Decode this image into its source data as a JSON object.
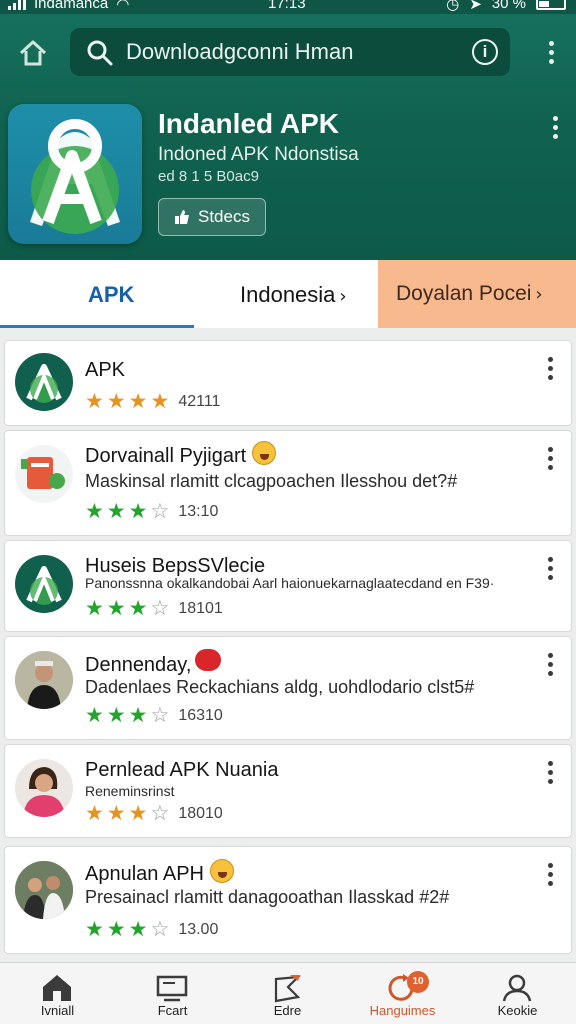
{
  "status_bar": {
    "carrier": "Indamanca",
    "time": "17:13",
    "battery": "30 %"
  },
  "search": {
    "query": "Downloadgconni Hman"
  },
  "app": {
    "title": "Indanled APK",
    "subtitle": "Indoned APK Ndonstisa",
    "meta": "ed 8 1 5 B0ac9",
    "stat_button": "Stdecs"
  },
  "tabs": [
    {
      "label": "APK"
    },
    {
      "label": "Indonesia"
    },
    {
      "label": "Doyalan Pocei"
    }
  ],
  "list": [
    {
      "title": "APK",
      "desc": "",
      "rating": 4,
      "count": "42111",
      "star_color": "#e7931f"
    },
    {
      "title": "Dorvainall Pyjigart",
      "desc": "Maskinsal rlamitt clcagpoachen Ilesshou det?#",
      "rating": 3,
      "count": "13:10",
      "star_color": "#22a52b"
    },
    {
      "title": "Huseis BepsSVlecie",
      "desc": "Panonssnna okalkandobai Aarl haionuekarnaglaatecdand en F39·",
      "rating": 3,
      "count": "18101",
      "star_color": "#22a52b"
    },
    {
      "title": "Dennenday,",
      "desc": "Dadenlaes Reckachians aldg, uohdlodario clst5#",
      "rating": 3,
      "count": "16310",
      "star_color": "#22a52b"
    },
    {
      "title": "Pernlead APK Nuania",
      "desc": "Reneminsrinst",
      "rating": 3,
      "count": "18010",
      "star_color": "#e7931f"
    },
    {
      "title": "Apnulan APH",
      "desc": "Presainacl rlamitt danagooathan Ilasskad #2#",
      "rating": 3,
      "count": "13.00",
      "star_color": "#22a52b"
    }
  ],
  "bottom_nav": [
    {
      "label": "Ivniall",
      "icon": "home-icon"
    },
    {
      "label": "Fcart",
      "icon": "screen-icon"
    },
    {
      "label": "Edre",
      "icon": "flag-icon"
    },
    {
      "label": "Hanguimes",
      "icon": "refresh-icon",
      "badge": "10"
    },
    {
      "label": "Keokie",
      "icon": "person-icon"
    }
  ]
}
